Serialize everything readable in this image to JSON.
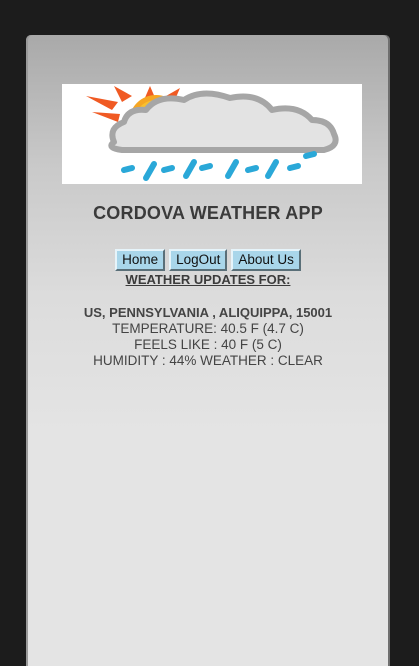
{
  "app": {
    "title": "CORDOVA WEATHER APP",
    "logo_icon": "sun-cloud-rain-icon"
  },
  "nav": {
    "home_label": "Home",
    "logout_label": "LogOut",
    "about_label": "About Us"
  },
  "weather": {
    "heading": "WEATHER UPDATES FOR:",
    "location": "US, PENNSYLVANIA , ALIQUIPPA, 15001",
    "temperature": "TEMPERATURE: 40.5 F (4.7 C)",
    "feels_like": "FEELS LIKE : 40 F (5 C)",
    "humidity_condition": "HUMIDITY : 44% WEATHER : CLEAR"
  },
  "colors": {
    "frame": "#1c1c1c",
    "button": "#a9d6ea",
    "text": "#3b3b3b",
    "sun": "#f6a623",
    "sun_rays": "#f05a23",
    "rain": "#2aa8d8"
  }
}
